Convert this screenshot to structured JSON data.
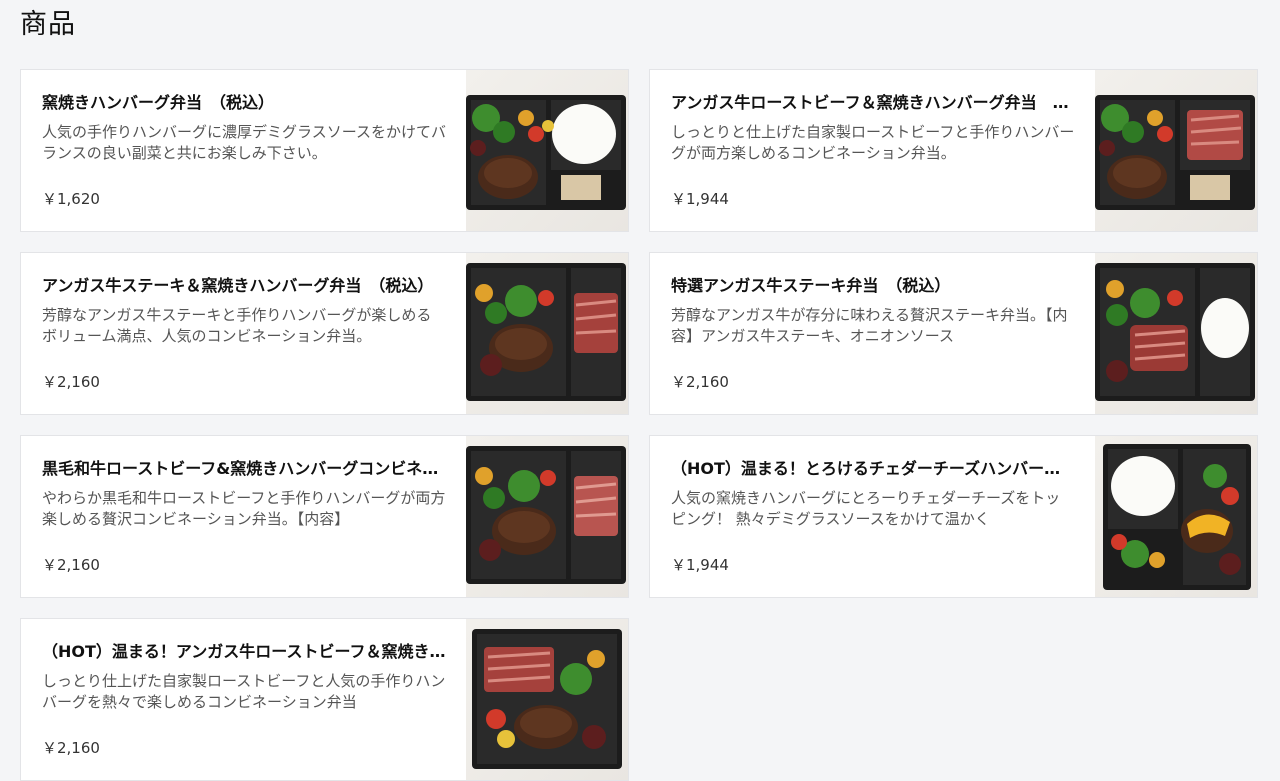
{
  "page": {
    "title": "商品"
  },
  "products": [
    {
      "title": "窯焼きハンバーグ弁当　（税込）",
      "description": "人気の手作りハンバーグに濃厚デミグラスソースをかけてバランスの良い副菜と共にお楽しみ下さい。",
      "price": "￥1,620",
      "image": "bento-hamburg-rice"
    },
    {
      "title": "アンガス牛ローストビーフ＆窯焼きハンバーグ弁当　（税込）",
      "description": "しっとりと仕上げた自家製ローストビーフと手作りハンバーグが両方楽しめるコンビネーション弁当。",
      "price": "￥1,944",
      "image": "bento-roastbeef-hamburg"
    },
    {
      "title": "アンガス牛ステーキ＆窯焼きハンバーグ弁当　（税込）",
      "description": "芳醇なアンガス牛ステーキと手作りハンバーグが楽しめるボリューム満点、人気のコンビネーション弁当。",
      "price": "￥2,160",
      "image": "bento-steak-hamburg"
    },
    {
      "title": "特選アンガス牛ステーキ弁当　（税込）",
      "description": "芳醇なアンガス牛が存分に味わえる贅沢ステーキ弁当。【内容】アンガス牛ステーキ、オニオンソース",
      "price": "￥2,160",
      "image": "bento-steak-rice"
    },
    {
      "title": "黒毛和牛ローストビーフ&窯焼きハンバーグコンビネーション弁当",
      "description": "やわらか黒毛和牛ローストビーフと手作りハンバーグが両方楽しめる贅沢コンビネーション弁当。【内容】",
      "price": "￥2,160",
      "image": "bento-wagyu-hamburg"
    },
    {
      "title": "（HOT）温まる！とろけるチェダーチーズハンバーグ弁当",
      "description": "人気の窯焼きハンバーグにとろーりチェダーチーズをトッピング！ 熱々デミグラスソースをかけて温かく",
      "price": "￥1,944",
      "image": "bento-cheese-hamburg"
    },
    {
      "title": "（HOT）温まる！アンガス牛ローストビーフ＆窯焼きハンバーグ弁当",
      "description": "しっとり仕上げた自家製ローストビーフと人気の手作りハンバーグを熱々で楽しめるコンビネーション弁当",
      "price": "￥2,160",
      "image": "bento-hot-roastbeef"
    }
  ],
  "colors": {
    "background": "#f4f5f7",
    "card": "#ffffff",
    "border": "#e3e4e7"
  }
}
